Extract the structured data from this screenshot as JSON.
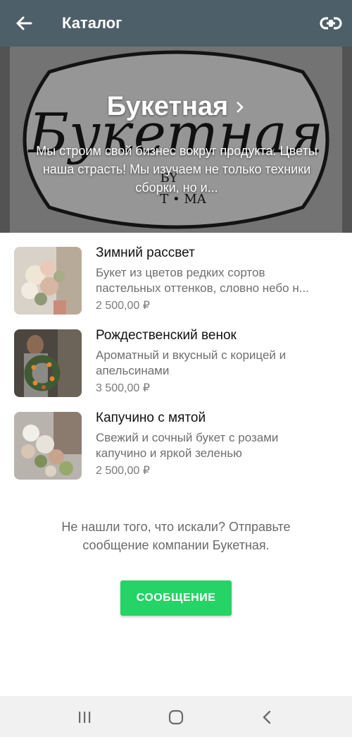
{
  "appbar": {
    "title": "Каталог",
    "back_icon": "arrow-left-icon",
    "link_icon": "link-icon",
    "background": "#4d5f68"
  },
  "banner": {
    "business_name": "Букетная",
    "description": "Мы строим свой бизнес вокруг продукта. Цветы наша страсть! Мы изучаем не только техники сборки, но и...",
    "logo_text": "Букетная",
    "logo_sub_left": "BY",
    "logo_sub_bottom": "T • MA"
  },
  "products": [
    {
      "name": "Зимний рассвет",
      "description": "Букет из цветов редких сортов\nпастельных оттенков, словно небо н...",
      "price": "2 500,00 ₽"
    },
    {
      "name": "Рождественский венок",
      "description": "Ароматный и вкусный с корицей и\nапельсинами",
      "price": "3 500,00 ₽"
    },
    {
      "name": "Капучино с мятой",
      "description": "Свежий и сочный букет с розами\nкапучино и яркой зеленью",
      "price": "2 500,00 ₽"
    }
  ],
  "footer": {
    "text": "Не нашли того, что искали? Отправьте сообщение компании Букетная.",
    "button_label": "СООБЩЕНИЕ",
    "button_color": "#25d366"
  },
  "system_nav": {
    "recents_icon": "recents-icon",
    "home_icon": "home-icon",
    "back_icon": "back-chevron-icon"
  }
}
